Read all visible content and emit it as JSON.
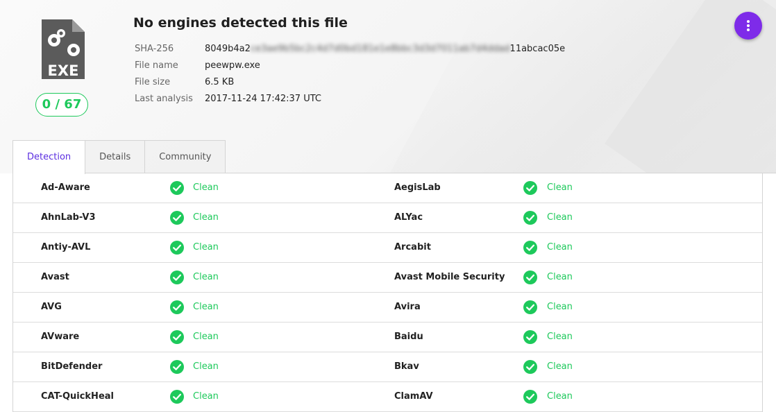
{
  "file": {
    "type_label": "EXE",
    "score": "0 / 67",
    "title": "No engines detected this file",
    "meta": [
      {
        "label": "SHA-256",
        "value_start": "8049b4a2",
        "value_hidden": "ce3ae9b5bc2c4d7d0bd181e1e8bbc3d3d7011ab7d4ddad",
        "value_end": "11abcac05e"
      },
      {
        "label": "File name",
        "value": "peewpw.exe"
      },
      {
        "label": "File size",
        "value": "6.5 KB"
      },
      {
        "label": "Last analysis",
        "value": "2017-11-24 17:42:37 UTC"
      }
    ]
  },
  "menu_icon": "more-vertical-icon",
  "colors": {
    "accent": "#7e2be9",
    "clean": "#1dc95b",
    "tab_active": "#5b2ee0"
  },
  "tabs": [
    {
      "label": "Detection",
      "active": true
    },
    {
      "label": "Details",
      "active": false
    },
    {
      "label": "Community",
      "active": false
    }
  ],
  "detections": [
    {
      "left": {
        "engine": "Ad-Aware",
        "status": "Clean"
      },
      "right": {
        "engine": "AegisLab",
        "status": "Clean"
      }
    },
    {
      "left": {
        "engine": "AhnLab-V3",
        "status": "Clean"
      },
      "right": {
        "engine": "ALYac",
        "status": "Clean"
      }
    },
    {
      "left": {
        "engine": "Antiy-AVL",
        "status": "Clean"
      },
      "right": {
        "engine": "Arcabit",
        "status": "Clean"
      }
    },
    {
      "left": {
        "engine": "Avast",
        "status": "Clean"
      },
      "right": {
        "engine": "Avast Mobile Security",
        "status": "Clean"
      }
    },
    {
      "left": {
        "engine": "AVG",
        "status": "Clean"
      },
      "right": {
        "engine": "Avira",
        "status": "Clean"
      }
    },
    {
      "left": {
        "engine": "AVware",
        "status": "Clean"
      },
      "right": {
        "engine": "Baidu",
        "status": "Clean"
      }
    },
    {
      "left": {
        "engine": "BitDefender",
        "status": "Clean"
      },
      "right": {
        "engine": "Bkav",
        "status": "Clean"
      }
    },
    {
      "left": {
        "engine": "CAT-QuickHeal",
        "status": "Clean"
      },
      "right": {
        "engine": "ClamAV",
        "status": "Clean"
      }
    }
  ]
}
